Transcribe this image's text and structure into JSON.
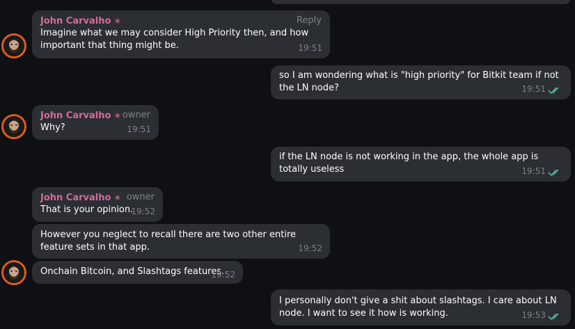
{
  "colors": {
    "background": "#0e1013",
    "bubble": "#2b2e33",
    "sender_name": "#d6699c",
    "meta_text": "#7d8288",
    "read_ticks": "#4fb7a3",
    "avatar_ring": "#e25b1b"
  },
  "messages": [
    {
      "sender": "John Carvalho",
      "tag": "Reply",
      "text": "Imagine what we may consider High Priority then, and how important that thing might be.",
      "time": "19:51"
    },
    {
      "text": "so I am wondering what is \"high priority\" for Bitkit team if not the LN node?",
      "time": "19:51",
      "status": "read"
    },
    {
      "sender": "John Carvalho",
      "tag": "owner",
      "text": "Why?",
      "time": "19:51"
    },
    {
      "text": "if the LN node is not working in the app, the whole app is totally useless",
      "time": "19:51",
      "status": "read"
    },
    {
      "sender": "John Carvalho",
      "tag": "owner",
      "text": "That is your opinion.",
      "time": "19:52"
    },
    {
      "text": "However you neglect to recall there are two other entire feature sets in that app.",
      "time": "19:52"
    },
    {
      "text": "Onchain Bitcoin, and Slashtags features.",
      "time": "19:52"
    },
    {
      "text": "I personally don't give a shit about slashtags. I care about LN node. I want to see it how is working.",
      "time": "19:53",
      "status": "read"
    }
  ]
}
